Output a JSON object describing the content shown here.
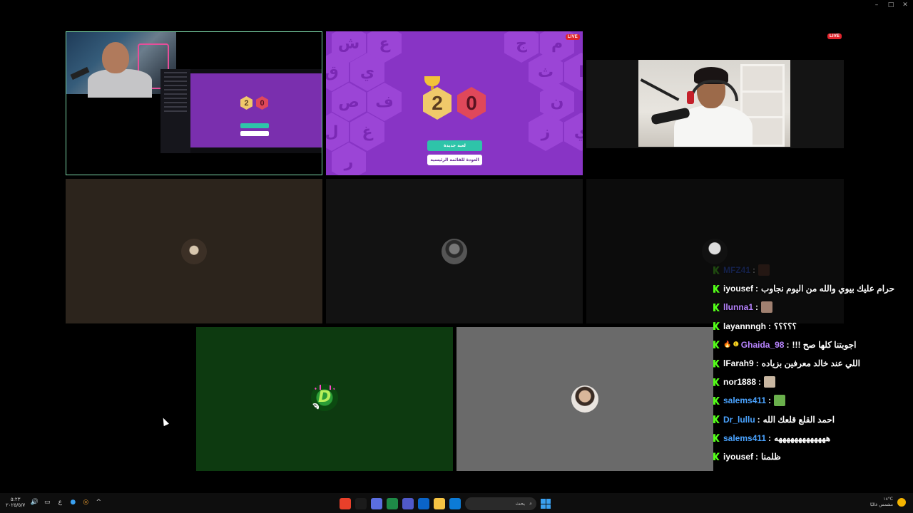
{
  "window": {
    "controls": [
      "–",
      "□",
      "✕"
    ]
  },
  "tiles": {
    "screen_share": {
      "score_left": "2",
      "score_right": "0"
    },
    "game": {
      "live_badge": "LIVE",
      "score_left": "2",
      "score_right": "0",
      "new_game_button": "لعبة جديدة",
      "home_button": "العودة للقائمة الرئيسية",
      "bg_letters": [
        "ش",
        "ع",
        "ق",
        "ي",
        "ص",
        "ف",
        "ل",
        "غ",
        "ر",
        "ج",
        "م",
        "ث",
        "ا",
        "ن",
        "ز",
        "ي"
      ]
    },
    "camera_right": {
      "live_badge": "LIVE"
    }
  },
  "chat": [
    {
      "user": "MFZ41",
      "color": "#2e5cff",
      "message": "",
      "emote": "#6b3a2a",
      "faded": true
    },
    {
      "user": "iyousef",
      "color": "#ffffff",
      "message": "حرام عليك بيوي والله من اليوم نجاوب"
    },
    {
      "user": "llunna1",
      "color": "#b884ff",
      "message": "",
      "emote": "#a08070"
    },
    {
      "user": "layannngh",
      "color": "#ffffff",
      "message": "؟؟؟؟؟"
    },
    {
      "user": "Ghaida_98",
      "color": "#b884ff",
      "prefix": "🔥 ❶",
      "message": "اجوبتنا كلها صح !!!"
    },
    {
      "user": "lFarah9",
      "color": "#ffffff",
      "message": "اللي عند خالد معرفين بزياده"
    },
    {
      "user": "nor1888",
      "color": "#ffffff",
      "message": "",
      "emote": "#c9b7a2"
    },
    {
      "user": "salems411",
      "color": "#4aa3ff",
      "message": "",
      "emote": "#6ab04c"
    },
    {
      "user": "Dr_lullu",
      "color": "#4aa3ff",
      "message": "احمد القلع قلعك الله"
    },
    {
      "user": "salems411",
      "color": "#4aa3ff",
      "message": "هههههههههههههه"
    },
    {
      "user": "iyousef",
      "color": "#ffffff",
      "message": "ظلمنا"
    }
  ],
  "taskbar": {
    "clock_time": "٥:٢٣",
    "clock_date": "٢٠٢٥/٥/٧",
    "lang": "ع",
    "search_placeholder": "بحث",
    "weather_temp": "١٨°C",
    "weather_desc": "مشمس غالبًا",
    "apps": [
      "#e8402a",
      "#1b1b1b",
      "#5b6ee1",
      "#1e8a47",
      "#5059c9",
      "#0a64c8",
      "#f6c443",
      "#0c7bd6",
      "#3e8ef7"
    ]
  }
}
